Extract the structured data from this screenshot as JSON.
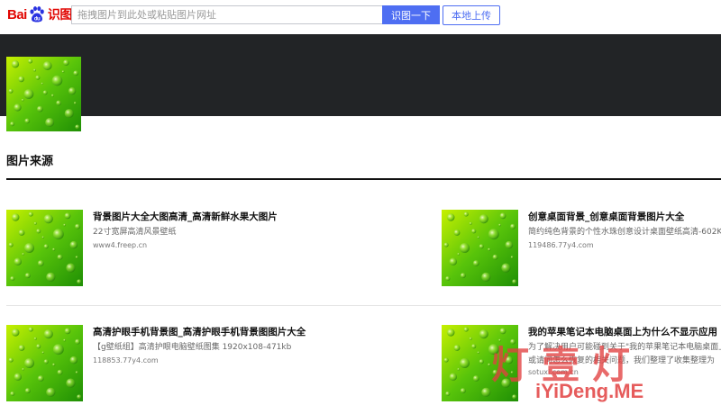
{
  "header": {
    "logo_text_left": "Bai",
    "logo_text_right": "识图",
    "search_placeholder": "拖拽图片到此处或粘贴图片网址",
    "search_button": "识图一下",
    "upload_button": "本地上传"
  },
  "colors": {
    "accent": "#4e6ef2",
    "brand_red": "#e10602",
    "banner_bg": "#222426"
  },
  "section": {
    "title": "图片来源"
  },
  "results": [
    {
      "title": "背景图片大全大图高清_高清新鲜水果大图片",
      "desc": "22寸宽屏高清风景壁纸",
      "url": "www4.freep.cn"
    },
    {
      "title": "创意桌面背景_创意桌面背景图片大全",
      "desc": "简约纯色背景的个性水珠创意设计桌面壁纸高清-602K",
      "url": "119486.77y4.com"
    },
    {
      "title": "高清护眼手机背景图_高清护眼手机背景图图片大全",
      "desc": "【g壁纸组】高清护眼电脑壁纸图集 1920x108-471kb",
      "url": "118853.77y4.com"
    },
    {
      "title": "我的苹果笔记本电脑桌面上为什么不显示应用",
      "desc": "为了解决用户可能碰到关于\"我的苹果笔记本电脑桌面上",
      "desc2": "或请问怎么恢复的相关问题，我们整理了收集整理为",
      "url": "sotuxi.com.cn"
    }
  ],
  "watermark": {
    "cn": "灯壹灯",
    "en": "iYiDeng.ME"
  }
}
